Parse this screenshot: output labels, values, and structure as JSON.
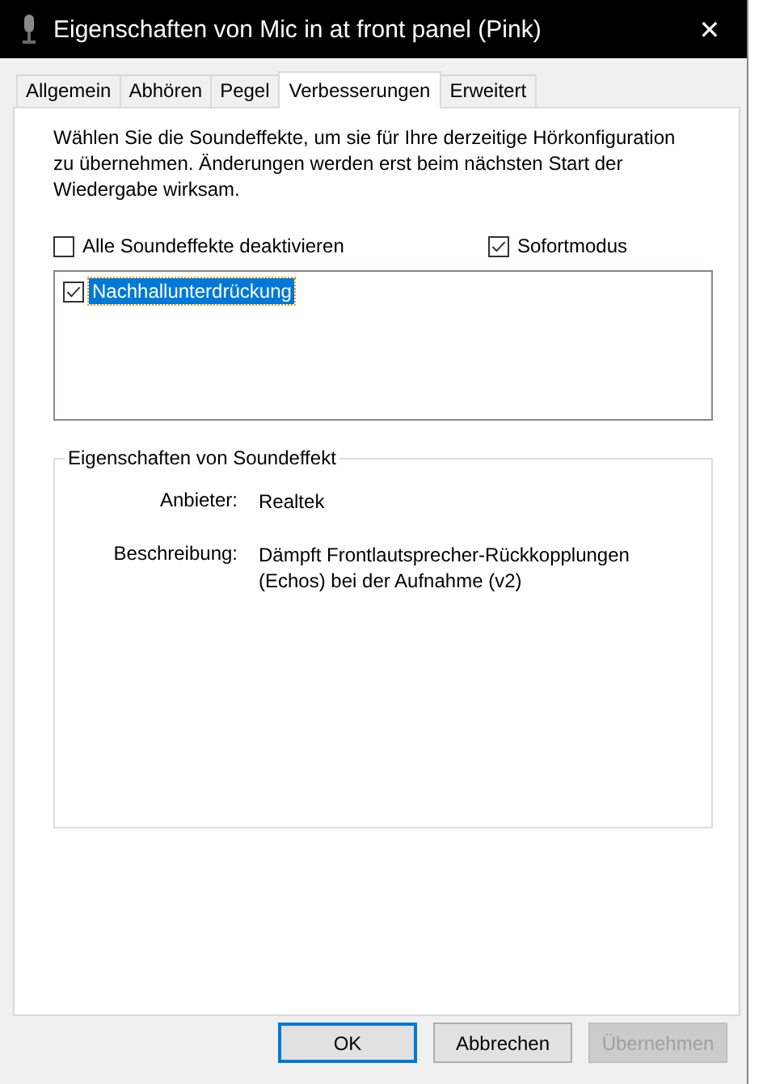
{
  "window": {
    "title": "Eigenschaften von Mic in at front panel (Pink)",
    "close": "✕"
  },
  "tabs": [
    {
      "label": "Allgemein",
      "selected": false
    },
    {
      "label": "Abhören",
      "selected": false
    },
    {
      "label": "Pegel",
      "selected": false
    },
    {
      "label": "Verbesserungen",
      "selected": true
    },
    {
      "label": "Erweitert",
      "selected": false
    }
  ],
  "description": "Wählen Sie die Soundeffekte, um sie für Ihre derzeitige Hörkonfiguration zu übernehmen. Änderungen werden erst beim nächsten Start der Wiedergabe wirksam.",
  "options": [
    {
      "label": "Alle Soundeffekte deaktivieren",
      "checked": false
    },
    {
      "label": "Sofortmodus",
      "checked": true
    }
  ],
  "effects": [
    {
      "label": "Nachhallunterdrückung",
      "checked": true,
      "selected": true
    }
  ],
  "properties": {
    "title": "Eigenschaften von Soundeffekt",
    "rows": [
      {
        "label": "Anbieter:",
        "value": "Realtek"
      },
      {
        "label": "Beschreibung:",
        "value": "Dämpft Frontlautsprecher-Rückkopplungen (Echos) bei der Aufnahme (v2)"
      }
    ]
  },
  "buttons": [
    {
      "label": "OK",
      "kind": "default",
      "disabled": false
    },
    {
      "label": "Abbrechen",
      "kind": "normal",
      "disabled": false
    },
    {
      "label": "Übernehmen",
      "kind": "normal",
      "disabled": true
    }
  ]
}
